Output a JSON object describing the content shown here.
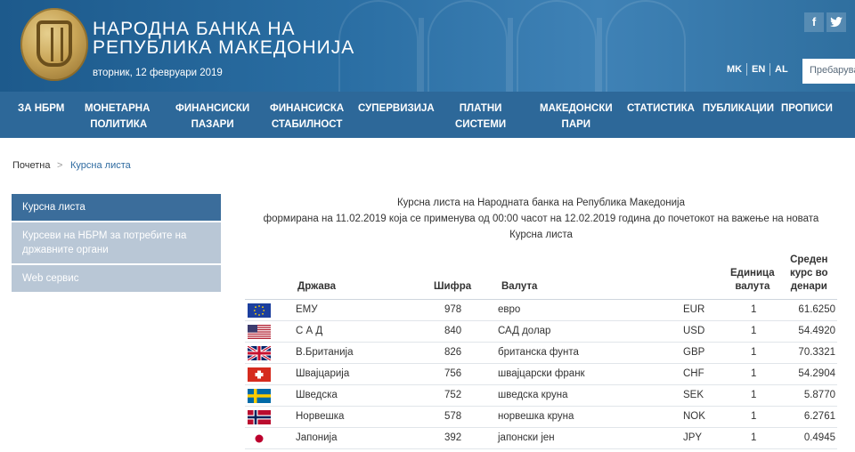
{
  "header": {
    "bank_name_line1": "НАРОДНА БАНКА НА",
    "bank_name_line2": "РЕПУБЛИКА МАКЕДОНИЈА",
    "date": "вторник,  12 февруари 2019",
    "social": [
      "f",
      "y"
    ],
    "languages": [
      "MK",
      "EN",
      "AL"
    ],
    "search_placeholder": "Пребарува"
  },
  "nav": [
    {
      "label": "ЗА НБРМ"
    },
    {
      "label": "МОНЕТАРНА\nПОЛИТИКА"
    },
    {
      "label": "ФИНАНСИСКИ\nПАЗАРИ"
    },
    {
      "label": "ФИНАНСИСКА\nСТАБИЛНОСТ"
    },
    {
      "label": "СУПЕРВИЗИЈА"
    },
    {
      "label": "ПЛАТНИ\nСИСТЕМИ"
    },
    {
      "label": "МАКЕДОНСКИ\nПАРИ"
    },
    {
      "label": "СТАТИСТИКА"
    },
    {
      "label": "ПУБЛИКАЦИИ"
    },
    {
      "label": "ПРОПИСИ"
    }
  ],
  "breadcrumb": {
    "home": "Почетна",
    "separator": ">",
    "current": "Курсна листа"
  },
  "sidebar": [
    {
      "label": "Курсна листа",
      "active": true
    },
    {
      "label": "Курсеви на НБРМ за потребите на државните органи",
      "active": false
    },
    {
      "label": "Web сервис",
      "active": false
    }
  ],
  "caption": {
    "line1": "Курсна листа на Народната банка на Република Македонија",
    "line2": "формирана на 11.02.2019 која се применува од 00:00 часот на 12.02.2019 година до почетокот на важење на новата",
    "line3": "Курсна листа"
  },
  "table": {
    "headers": {
      "country": "Држава",
      "code": "Шифра",
      "currency": "Валута",
      "unit": "Единица\nвалута",
      "rate": "Среден\nкурс во\nденари"
    },
    "rows": [
      {
        "flag": "eu-flag-icon",
        "country": "ЕМУ",
        "code": "978",
        "currency": "евро",
        "iso": "EUR",
        "unit": "1",
        "rate": "61.6250"
      },
      {
        "flag": "us-flag-icon",
        "country": "С А Д",
        "code": "840",
        "currency": "САД долар",
        "iso": "USD",
        "unit": "1",
        "rate": "54.4920"
      },
      {
        "flag": "uk-flag-icon",
        "country": "В.Британија",
        "code": "826",
        "currency": "британска фунта",
        "iso": "GBP",
        "unit": "1",
        "rate": "70.3321"
      },
      {
        "flag": "ch-flag-icon",
        "country": "Швајцарија",
        "code": "756",
        "currency": "швајцарски франк",
        "iso": "CHF",
        "unit": "1",
        "rate": "54.2904"
      },
      {
        "flag": "se-flag-icon",
        "country": "Шведска",
        "code": "752",
        "currency": "шведска круна",
        "iso": "SEK",
        "unit": "1",
        "rate": "5.8770"
      },
      {
        "flag": "no-flag-icon",
        "country": "Норвешка",
        "code": "578",
        "currency": "норвешка круна",
        "iso": "NOK",
        "unit": "1",
        "rate": "6.2761"
      },
      {
        "flag": "jp-flag-icon",
        "country": "Јапонија",
        "code": "392",
        "currency": "јапонски јен",
        "iso": "JPY",
        "unit": "1",
        "rate": "0.4945"
      }
    ]
  },
  "colors": {
    "header_bg": "#2a6ea3",
    "nav_bg": "#2d6899",
    "sidebar_active": "#3b6d9b",
    "sidebar_inactive": "#b9c7d6",
    "link": "#2e6aa0"
  }
}
